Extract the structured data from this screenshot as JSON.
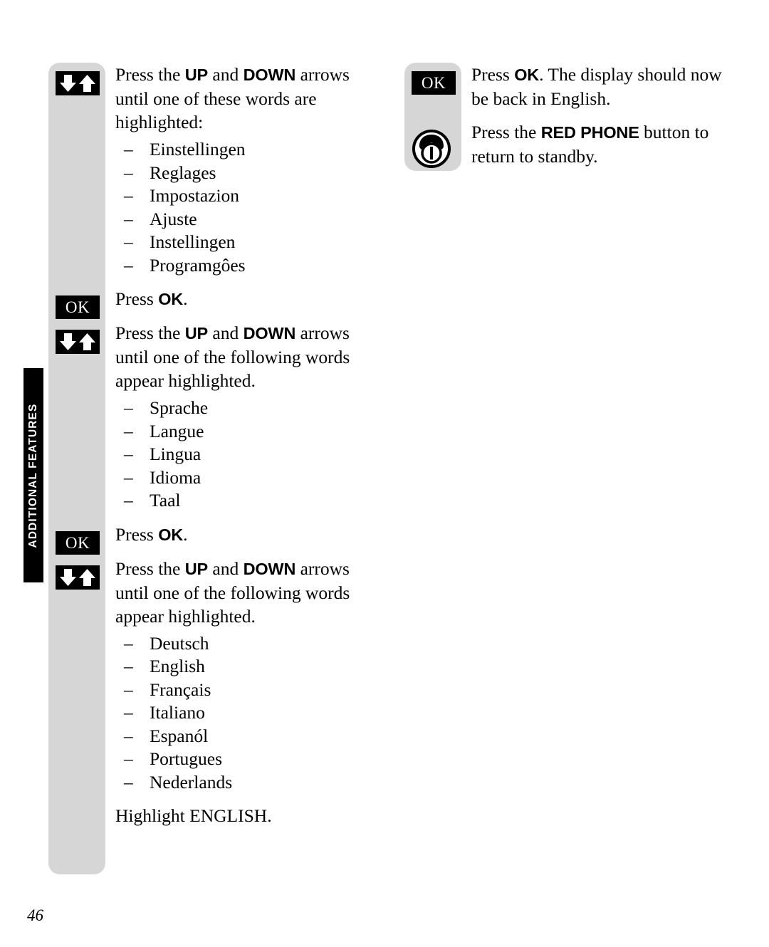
{
  "page": {
    "number": "46",
    "side_tab_label": "ADDITIONAL FEATURES",
    "colors": {
      "gray_strip": "#d6d6d6",
      "icon_black": "#000000",
      "text": "#000000"
    }
  },
  "icons": {
    "updown": "up-down-arrows-icon",
    "ok": "OK",
    "red_phone": "red-phone-power-icon"
  },
  "left_column": {
    "steps": [
      {
        "icon": "updown",
        "text_parts": [
          {
            "type": "plain",
            "text": "Press the "
          },
          {
            "type": "kw",
            "text": "UP"
          },
          {
            "type": "plain",
            "text": " and "
          },
          {
            "type": "kw",
            "text": "DOWN"
          },
          {
            "type": "plain",
            "text": " arrows until one of these words are highlighted:"
          }
        ],
        "text_flat": "Press the UP and DOWN arrows until one of these words are highlighted:",
        "list": [
          "Einstellingen",
          "Reglages",
          "Impostazion",
          "Ajuste",
          "Instellingen",
          "Programgôes"
        ]
      },
      {
        "icon": "ok",
        "text_parts": [
          {
            "type": "plain",
            "text": "Press "
          },
          {
            "type": "kw",
            "text": "OK"
          },
          {
            "type": "plain",
            "text": "."
          }
        ],
        "text_flat": "Press OK.",
        "list": []
      },
      {
        "icon": "updown",
        "text_parts": [
          {
            "type": "plain",
            "text": "Press the "
          },
          {
            "type": "kw",
            "text": "UP"
          },
          {
            "type": "plain",
            "text": " and "
          },
          {
            "type": "kw",
            "text": "DOWN"
          },
          {
            "type": "plain",
            "text": " arrows until one of the following words appear highlighted."
          }
        ],
        "text_flat": "Press the UP and DOWN arrows until one of the following words appear highlighted.",
        "list": [
          "Sprache",
          "Langue",
          "Lingua",
          "Idioma",
          "Taal"
        ]
      },
      {
        "icon": "ok",
        "text_parts": [
          {
            "type": "plain",
            "text": "Press "
          },
          {
            "type": "kw",
            "text": "OK"
          },
          {
            "type": "plain",
            "text": "."
          }
        ],
        "text_flat": "Press OK.",
        "list": []
      },
      {
        "icon": "updown",
        "text_parts": [
          {
            "type": "plain",
            "text": "Press the "
          },
          {
            "type": "kw",
            "text": "UP"
          },
          {
            "type": "plain",
            "text": " and "
          },
          {
            "type": "kw",
            "text": "DOWN"
          },
          {
            "type": "plain",
            "text": " arrows until one of the following words appear highlighted."
          }
        ],
        "text_flat": "Press the UP and DOWN arrows until one of the following words appear highlighted.",
        "list": [
          "Deutsch",
          "English",
          "Français",
          "Italiano",
          "Espanól",
          "Portugues",
          "Nederlands"
        ]
      }
    ],
    "closing_note": {
      "prefix": "Highlight ",
      "smallcaps": "ENGLISH",
      "suffix": "."
    },
    "dash": "–"
  },
  "right_column": {
    "steps": [
      {
        "icon": "ok",
        "text_parts": [
          {
            "type": "plain",
            "text": "Press "
          },
          {
            "type": "kw",
            "text": "OK"
          },
          {
            "type": "plain",
            "text": ". The display should now be back in English."
          }
        ],
        "text_flat": "Press OK. The display should now be back in English."
      },
      {
        "icon": "red_phone",
        "text_parts": [
          {
            "type": "plain",
            "text": "Press the "
          },
          {
            "type": "kw",
            "text": "RED PHONE"
          },
          {
            "type": "plain",
            "text": " button to return to standby."
          }
        ],
        "text_flat": "Press the RED PHONE button to return to standby."
      }
    ]
  }
}
